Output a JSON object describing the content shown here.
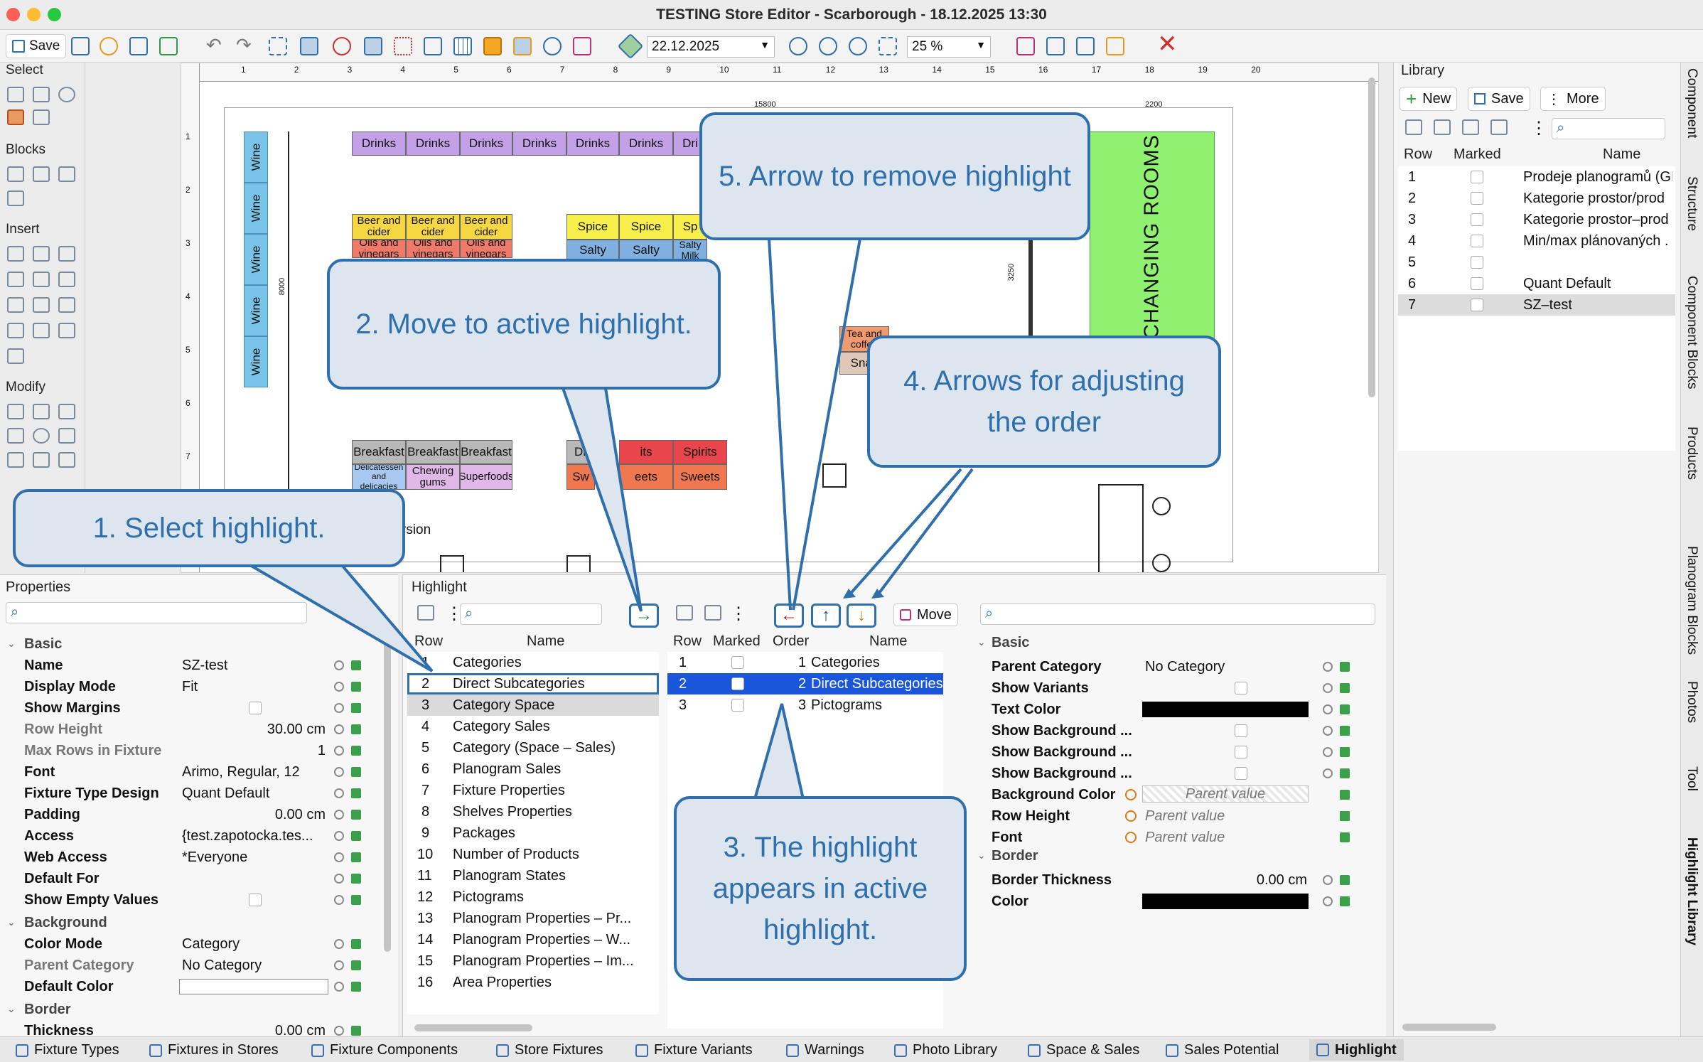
{
  "window": {
    "title": "TESTING Store Editor - Scarborough - 18.12.2025 13:30"
  },
  "toolbar": {
    "save_label": "Save",
    "date_value": "22.12.2025",
    "zoom_value": "25 %"
  },
  "left_tools": {
    "select": "Select",
    "blocks": "Blocks",
    "insert": "Insert",
    "modify": "Modify"
  },
  "canvas": {
    "drinks_label": "Drinks",
    "dri_label": "Dri",
    "wine_label": "Wine",
    "beer_label": "Beer and cider",
    "oils_label": "Oils and vinegars",
    "spice_label": "Spice",
    "sp_label": "Sp",
    "salty_label": "Salty",
    "salty_milk_label": "Salty Milk",
    "breakfast_label": "Breakfast",
    "delicatessen_label": "Delicatessen and delicacies",
    "chewing_label": "Chewing gums",
    "superfoods_label": "Superfoods",
    "spirits_label": "Spirits",
    "its_label": "its",
    "sweets_label": "Sweets",
    "sw_label": "Sw",
    "dr_label": "Dr",
    "eets_label": "eets",
    "tea_label": "Tea and coffee",
    "snac_label": "Snac",
    "changing_rooms": "CHANGING ROOMS",
    "rsion_label": "rsion",
    "dim_15800": "15800",
    "dim_2200": "2200",
    "dim_8000": "8000",
    "dim_3250": "3250",
    "ruler_h": [
      "1",
      "2",
      "3",
      "4",
      "5",
      "6",
      "7",
      "8",
      "9",
      "10",
      "11",
      "12",
      "13",
      "14",
      "15",
      "16",
      "17",
      "18",
      "19",
      "20"
    ],
    "ruler_v": [
      "1",
      "2",
      "3",
      "4",
      "5",
      "6",
      "7"
    ]
  },
  "library": {
    "title": "Library",
    "new_label": "New",
    "save_label": "Save",
    "more_label": "More",
    "col_row": "Row",
    "col_marked": "Marked",
    "col_name": "Name",
    "rows": [
      {
        "row": "1",
        "name": "Prodeje planogramů (GI"
      },
      {
        "row": "2",
        "name": "Kategorie prostor/prod"
      },
      {
        "row": "3",
        "name": "Kategorie prostor–prod"
      },
      {
        "row": "4",
        "name": "Min/max plánovaných ."
      },
      {
        "row": "5",
        "name": ""
      },
      {
        "row": "6",
        "name": "Quant Default"
      },
      {
        "row": "7",
        "name": "SZ–test"
      }
    ]
  },
  "side_tabs": [
    "Component",
    "Structure",
    "Component Blocks",
    "Products",
    "Planogram Blocks",
    "Photos",
    "Tool",
    "Highlight Library"
  ],
  "properties": {
    "title": "Properties",
    "groups": {
      "basic": "Basic",
      "background": "Background",
      "border": "Border"
    },
    "rows": [
      {
        "key": "Name",
        "value": "SZ-test"
      },
      {
        "key": "Display Mode",
        "value": "Fit"
      },
      {
        "key": "Show Margins",
        "value": ""
      },
      {
        "key": "Row Height",
        "value": "30.00 cm"
      },
      {
        "key": "Max Rows in Fixture",
        "value": "1"
      },
      {
        "key": "Font",
        "value": "Arimo, Regular, 12"
      },
      {
        "key": "Fixture Type Design",
        "value": "Quant Default"
      },
      {
        "key": "Padding",
        "value": "0.00 cm"
      },
      {
        "key": "Access",
        "value": "{test.zapotocka.tes..."
      },
      {
        "key": "Web Access",
        "value": "*Everyone"
      },
      {
        "key": "Default For",
        "value": ""
      },
      {
        "key": "Show Empty Values",
        "value": ""
      },
      {
        "key": "Color Mode",
        "value": "Category"
      },
      {
        "key": "Parent Category",
        "value": "No Category"
      },
      {
        "key": "Default Color",
        "value": ""
      },
      {
        "key": "Thickness",
        "value": "0.00 cm"
      }
    ]
  },
  "highlight": {
    "title": "Highlight",
    "col_row": "Row",
    "col_name": "Name",
    "col_marked": "Marked",
    "col_order": "Order",
    "move_label": "Move",
    "items": [
      {
        "row": "1",
        "name": "Categories"
      },
      {
        "row": "2",
        "name": "Direct Subcategories"
      },
      {
        "row": "3",
        "name": "Category Space"
      },
      {
        "row": "4",
        "name": "Category Sales"
      },
      {
        "row": "5",
        "name": "Category (Space – Sales)"
      },
      {
        "row": "6",
        "name": "Planogram Sales"
      },
      {
        "row": "7",
        "name": "Fixture Properties"
      },
      {
        "row": "8",
        "name": "Shelves Properties"
      },
      {
        "row": "9",
        "name": "Packages"
      },
      {
        "row": "10",
        "name": "Number of Products"
      },
      {
        "row": "11",
        "name": "Planogram States"
      },
      {
        "row": "12",
        "name": "Pictograms"
      },
      {
        "row": "13",
        "name": "Planogram Properties – Pr..."
      },
      {
        "row": "14",
        "name": "Planogram Properties – W..."
      },
      {
        "row": "15",
        "name": "Planogram Properties – Im..."
      },
      {
        "row": "16",
        "name": "Area Properties"
      }
    ],
    "active": [
      {
        "row": "1",
        "order": "1",
        "name": "Categories"
      },
      {
        "row": "2",
        "order": "2",
        "name": "Direct Subcategories"
      },
      {
        "row": "3",
        "order": "3",
        "name": "Pictograms"
      }
    ],
    "detail": {
      "basic": "Basic",
      "border": "Border",
      "rows": [
        {
          "key": "Parent Category",
          "value": "No Category"
        },
        {
          "key": "Show Variants",
          "value": ""
        },
        {
          "key": "Text Color",
          "value": ""
        },
        {
          "key": "Show Background ...",
          "value": ""
        },
        {
          "key": "Show Background ...",
          "value": ""
        },
        {
          "key": "Show Background ...",
          "value": ""
        },
        {
          "key": "Background Color",
          "value": "Parent value"
        },
        {
          "key": "Row Height",
          "value": "Parent value"
        },
        {
          "key": "Font",
          "value": "Parent value"
        },
        {
          "key": "Border Thickness",
          "value": "0.00 cm"
        },
        {
          "key": "Color",
          "value": ""
        }
      ]
    }
  },
  "callouts": {
    "c1": "1. Select highlight.",
    "c2": "2. Move to active highlight.",
    "c3": "3. The highlight appears in active highlight.",
    "c4": "4. Arrows for adjusting the order",
    "c5": "5. Arrow to remove highlight"
  },
  "bottom_tabs": [
    "Fixture Types",
    "Fixtures in Stores",
    "Fixture Components",
    "Store Fixtures",
    "Fixture Variants",
    "Warnings",
    "Photo Library",
    "Space & Sales",
    "Sales Potential",
    "Highlight"
  ],
  "colors": {
    "accent": "#2f6fab",
    "selection": "#1a56db",
    "drinks": "#c4a0e6",
    "wine": "#79c3e8",
    "beer": "#f5d742",
    "oils": "#f07a6a",
    "spice": "#f8ef4a",
    "salty": "#7fb0e0",
    "breakfast": "#b8b8b8",
    "spirits": "#e8464a",
    "sweets": "#f07850",
    "changing": "#90f070"
  }
}
